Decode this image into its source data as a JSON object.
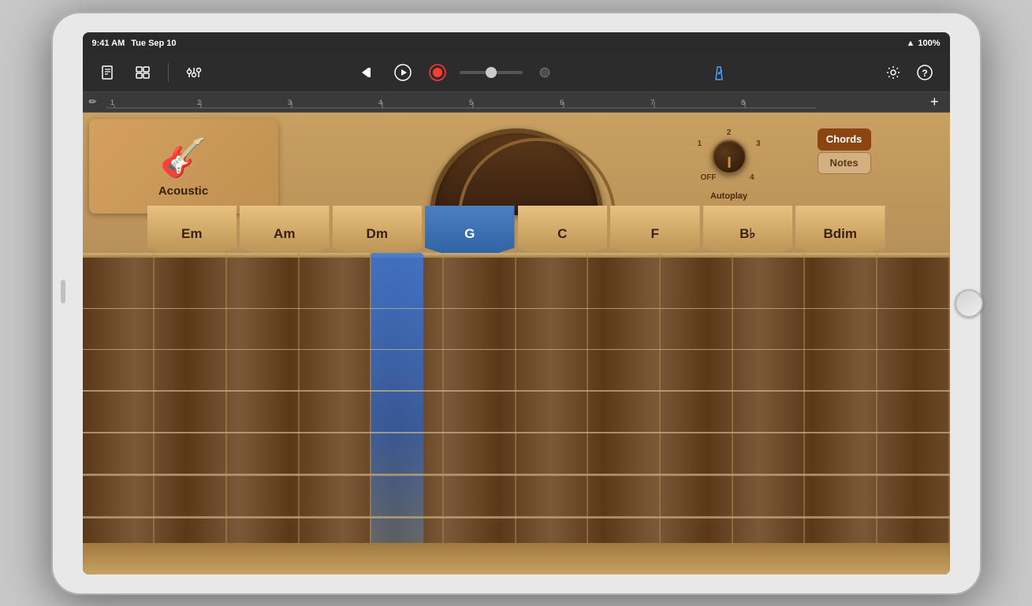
{
  "status_bar": {
    "time": "9:41 AM",
    "date": "Tue Sep 10",
    "wifi": "WiFi",
    "battery": "100%"
  },
  "toolbar": {
    "new_song": "📄",
    "tracks": "⊞",
    "mixer": "⚙",
    "skip_back": "⏮",
    "play": "▶",
    "record": "⏺",
    "metronome": "🔔",
    "settings": "⚙",
    "help": "?"
  },
  "timeline": {
    "pencil": "✏",
    "marks": [
      "1",
      "2",
      "3",
      "4",
      "5",
      "6",
      "7",
      "8"
    ],
    "plus": "+"
  },
  "instrument": {
    "name": "Acoustic",
    "icon": "🎸"
  },
  "autoplay": {
    "label": "Autoplay",
    "positions": [
      "OFF",
      "1",
      "2",
      "3",
      "4"
    ]
  },
  "chord_notes": {
    "chords_label": "Chords",
    "notes_label": "Notes",
    "active": "Chords"
  },
  "chords": [
    {
      "label": "Em",
      "active": false
    },
    {
      "label": "Am",
      "active": false
    },
    {
      "label": "Dm",
      "active": false
    },
    {
      "label": "G",
      "active": true
    },
    {
      "label": "C",
      "active": false
    },
    {
      "label": "F",
      "active": false
    },
    {
      "label": "B♭",
      "active": false
    },
    {
      "label": "Bdim",
      "active": false
    }
  ],
  "strings": 6
}
